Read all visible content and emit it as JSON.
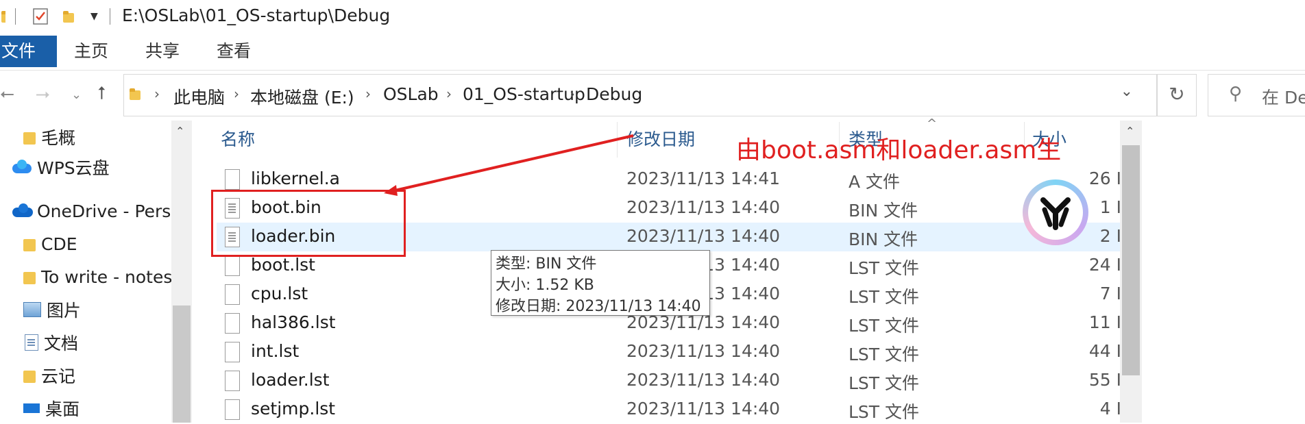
{
  "window": {
    "title_path": "E:\\OSLab\\01_OS-startup\\Debug"
  },
  "ribbon": {
    "tabs": [
      "文件",
      "主页",
      "共享",
      "查看"
    ]
  },
  "address": {
    "crumbs": [
      "此电脑",
      "本地磁盘 (E:)",
      "OSLab",
      "01_OS-startup",
      "Debug"
    ],
    "search_placeholder": "在 De"
  },
  "nav": {
    "items": [
      {
        "label": "毛概",
        "icon": "folder-icon"
      },
      {
        "label": "WPS云盘",
        "icon": "wps-cloud-icon"
      },
      {
        "label": "OneDrive - Perso",
        "icon": "onedrive-icon"
      },
      {
        "label": "CDE",
        "icon": "folder-icon"
      },
      {
        "label": "To write - notes",
        "icon": "folder-icon"
      },
      {
        "label": "图片",
        "icon": "pictures-icon"
      },
      {
        "label": "文档",
        "icon": "documents-icon"
      },
      {
        "label": "云记",
        "icon": "folder-icon"
      },
      {
        "label": "桌面",
        "icon": "desktop-icon"
      }
    ]
  },
  "columns": {
    "name": "名称",
    "date": "修改日期",
    "type": "类型",
    "size": "大小"
  },
  "files": [
    {
      "name": "libkernel.a",
      "date": "2023/11/13 14:41",
      "type": "A 文件",
      "size": "26 I",
      "icon": "file-icon"
    },
    {
      "name": "boot.bin",
      "date": "2023/11/13 14:40",
      "type": "BIN 文件",
      "size": "1 I",
      "icon": "bin-file-icon"
    },
    {
      "name": "loader.bin",
      "date": "2023/11/13 14:40",
      "type": "BIN 文件",
      "size": "2 I",
      "icon": "bin-file-icon"
    },
    {
      "name": "boot.lst",
      "date": "2023/11/13 14:40",
      "type": "LST 文件",
      "size": "24 I",
      "icon": "file-icon"
    },
    {
      "name": "cpu.lst",
      "date": "2023/11/13 14:40",
      "type": "LST 文件",
      "size": "7 I",
      "icon": "file-icon"
    },
    {
      "name": "hal386.lst",
      "date": "2023/11/13 14:40",
      "type": "LST 文件",
      "size": "11 I",
      "icon": "file-icon"
    },
    {
      "name": "int.lst",
      "date": "2023/11/13 14:40",
      "type": "LST 文件",
      "size": "44 I",
      "icon": "file-icon"
    },
    {
      "name": "loader.lst",
      "date": "2023/11/13 14:40",
      "type": "LST 文件",
      "size": "55 I",
      "icon": "file-icon"
    },
    {
      "name": "setjmp.lst",
      "date": "2023/11/13 14:40",
      "type": "LST 文件",
      "size": "4 I",
      "icon": "file-icon"
    }
  ],
  "tooltip": {
    "line1": "类型: BIN 文件",
    "line2": "大小: 1.52 KB",
    "line3": "修改日期: 2023/11/13 14:40"
  },
  "annotation": {
    "text": "由boot.asm和loader.asm生",
    "color": "#e02020"
  },
  "colors": {
    "accent": "#1a5fa8",
    "selection": "#e5f3ff"
  }
}
